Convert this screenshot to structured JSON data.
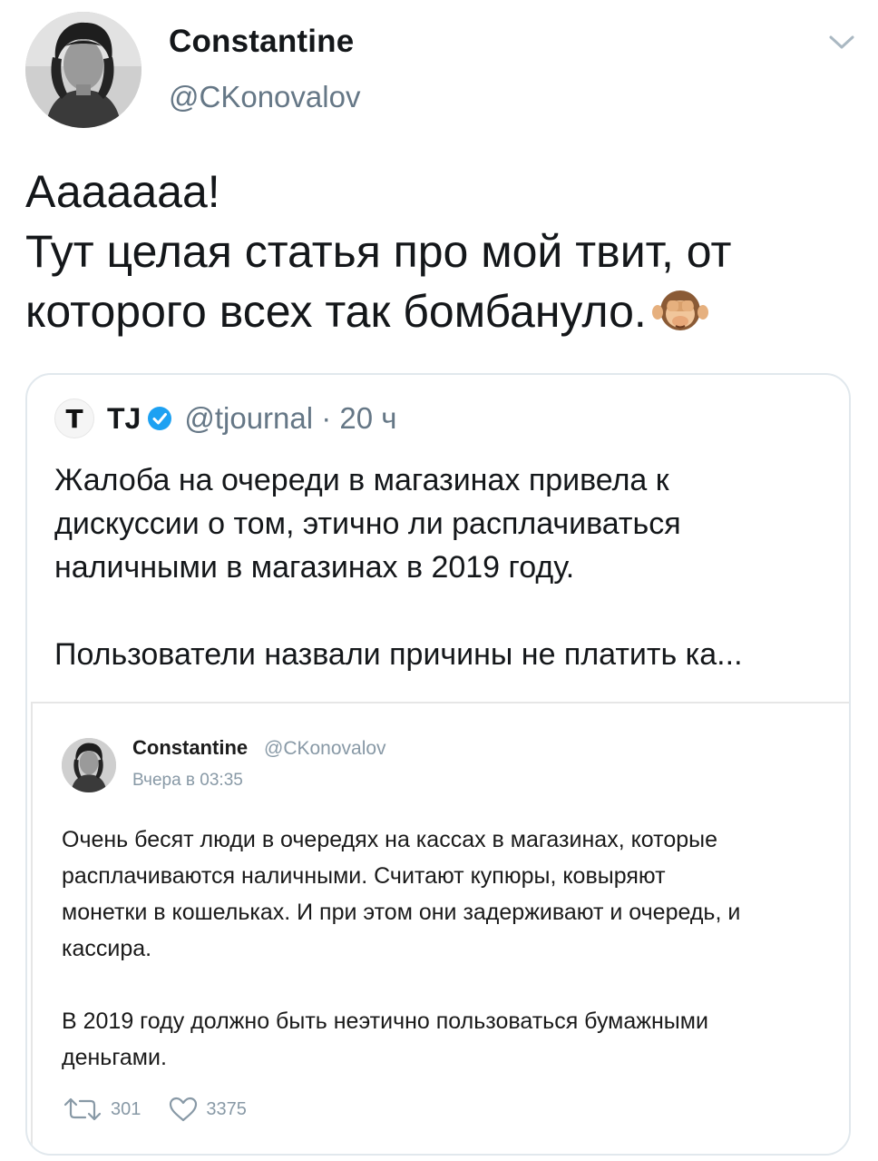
{
  "tweet": {
    "author": {
      "display_name": "Constantine",
      "handle": "@CKonovalov",
      "avatar_icon": "avatar-photo"
    },
    "menu_icon": "chevron-down-icon",
    "text_lines": [
      "Ааааааа!",
      "Тут целая статья про мой твит, от",
      "которого всех так бомбануло."
    ],
    "emoji": "see-no-evil-monkey-icon"
  },
  "quoted": {
    "author": {
      "logo": "T",
      "name": "TJ",
      "verified_icon": "verified-badge-icon",
      "handle_time": "@tjournal · 20 ч"
    },
    "text_lines": [
      "Жалоба на очереди в магазинах привела к",
      "дискуссии о том, этично ли расплачиваться",
      "наличными в магазинах в 2019 году."
    ],
    "text_lines_2": [
      "Пользователи назвали причины не платить ка..."
    ],
    "embedded": {
      "name": "Constantine",
      "handle": "@CKonovalov",
      "date": "Вчера в 03:35",
      "bird_icon": "twitter-bird-icon",
      "text_lines": [
        "Очень бесят люди в очередях на кассах в магазинах, которые",
        "расплачиваются наличными. Считают купюры, ковыряют",
        "монетки в кошельках. И при этом они задерживают и очередь, и",
        "кассира."
      ],
      "text_lines_2": [
        "В 2019 году должно быть неэтично пользоваться бумажными",
        "деньгами."
      ],
      "retweets": "301",
      "likes": "3375"
    }
  },
  "colors": {
    "text": "#14171a",
    "secondary": "#657786",
    "verified": "#1da1f2",
    "border": "#e1e8ed"
  }
}
